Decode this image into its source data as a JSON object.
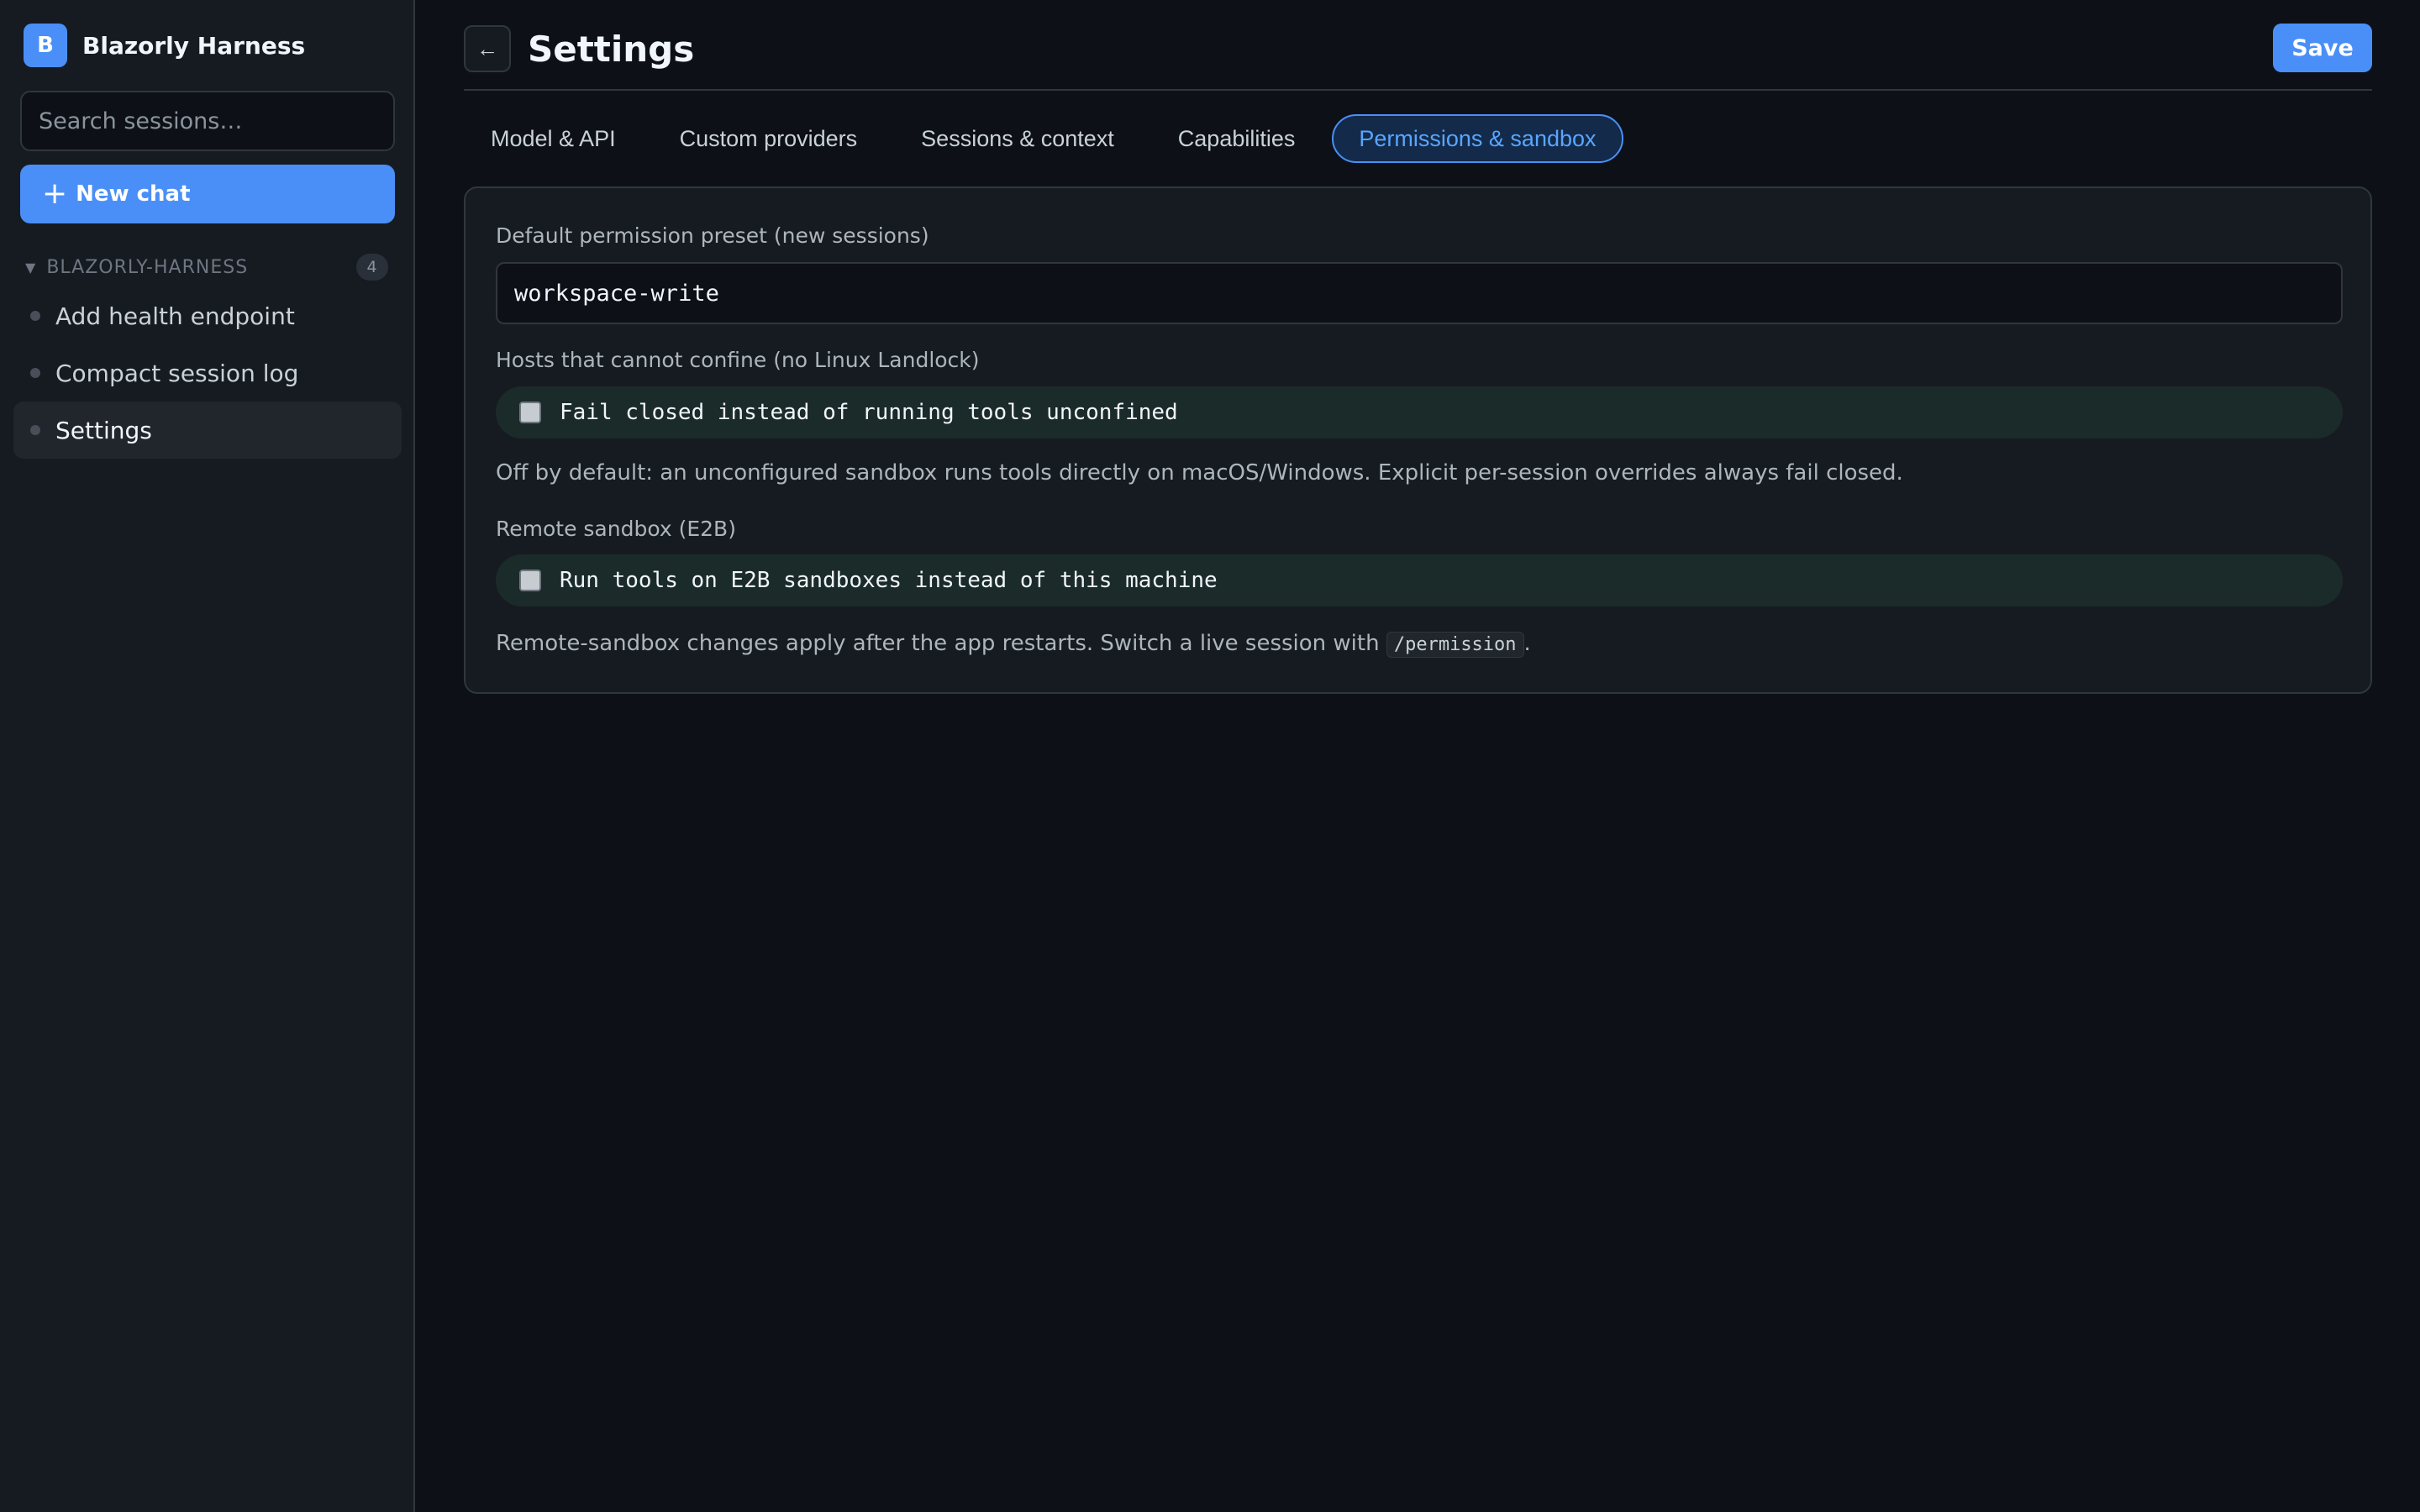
{
  "sidebar": {
    "logo_letter": "B",
    "app_name": "Blazorly Harness",
    "search_placeholder": "Search sessions…",
    "new_chat_icon": "+",
    "new_chat_label": "New chat",
    "group": {
      "caret": "▼",
      "name": "BLAZORLY-HARNESS",
      "count": "4"
    },
    "sessions": [
      {
        "label": "Add health endpoint",
        "active": false
      },
      {
        "label": "Compact session log",
        "active": false
      },
      {
        "label": "Settings",
        "active": true
      }
    ]
  },
  "header": {
    "back_icon": "←",
    "title": "Settings",
    "save_label": "Save"
  },
  "tabs": [
    {
      "label": "Model & API",
      "active": false
    },
    {
      "label": "Custom providers",
      "active": false
    },
    {
      "label": "Sessions & context",
      "active": false
    },
    {
      "label": "Capabilities",
      "active": false
    },
    {
      "label": "Permissions & sandbox",
      "active": true
    }
  ],
  "permissions": {
    "preset_label": "Default permission preset (new sessions)",
    "preset_value": "workspace-write",
    "confine_label": "Hosts that cannot confine (no Linux Landlock)",
    "fail_closed": {
      "label": "Fail closed instead of running tools unconfined",
      "checked": false
    },
    "confine_hint": "Off by default: an unconfigured sandbox runs tools directly on macOS/Windows. Explicit per-session overrides always fail closed.",
    "remote_label": "Remote sandbox (E2B)",
    "remote_e2b": {
      "label": "Run tools on E2B sandboxes instead of this machine",
      "checked": false
    },
    "remote_hint_prefix": "Remote-sandbox changes apply after the app restarts. Switch a live session with ",
    "remote_hint_code": "/permission",
    "remote_hint_suffix": "."
  },
  "colors": {
    "accent": "#4a8ff7",
    "background": "#0d1117",
    "sidebar_bg": "#161b22",
    "check_row_bg": "#1b2b29"
  }
}
